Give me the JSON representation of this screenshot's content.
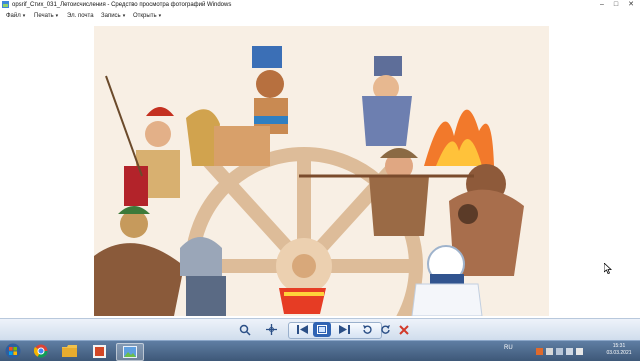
{
  "window": {
    "title": "opsrif_Стих_031_Летоисчисления - Средство просмотра фотографий Windows",
    "controls": {
      "minimize": "–",
      "maximize": "□",
      "close": "✕"
    }
  },
  "menu": {
    "items": [
      {
        "label": "Файл"
      },
      {
        "label": "Печать"
      },
      {
        "label": "Эл. почта"
      },
      {
        "label": "Запись"
      },
      {
        "label": "Открыть"
      }
    ],
    "help": "?"
  },
  "photo": {
    "subject": "illustration-historical-figures-around-wheel"
  },
  "controls_bar": {
    "zoom_icon": "zoom-icon",
    "fit_icon": "fit-to-window-icon",
    "prev_icon": "previous-icon",
    "slideshow_icon": "slideshow-icon",
    "next_icon": "next-icon",
    "rotate_ccw_icon": "rotate-ccw-icon",
    "rotate_cw_icon": "rotate-cw-icon",
    "delete_icon": "delete-icon"
  },
  "taskbar": {
    "lang": "RU",
    "time": "15:31",
    "date": "03.03.2021"
  },
  "colors": {
    "accent": "#2a66c9",
    "taskbar": "#4a6687",
    "delete": "#d23a2a"
  }
}
